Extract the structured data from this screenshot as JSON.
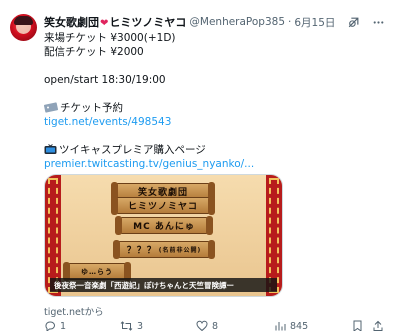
{
  "post": {
    "author": {
      "display_name": "笑女歌劇団",
      "display_name_suffix": "ヒミツノミヤコ",
      "handle": "@MenheraPop385",
      "separator": "·",
      "date": "6月15日"
    },
    "lines": [
      "来場チケット ¥3000(+1D)",
      "配信チケット ¥2000",
      "",
      "open/start 18:30/19:00",
      "",
      "チケット予約",
      "tiget.net/events/498543",
      "",
      "ツイキャスプレミア購入ページ",
      "premier.twitcasting.tv/genius_nyanko/..."
    ],
    "media": {
      "scroll_texts": [
        "笑女歌劇団",
        "ヒミツノミヤコ",
        "MC あんにゅ",
        "？？？",
        "ゆ…らう"
      ],
      "scroll_small": "(名前非公開)",
      "caption": "後夜祭一音楽劇「西遊記」ぽけちゃんと天竺冒険譚ー"
    },
    "source_label": "tiget.netから",
    "metrics": {
      "replies": "1",
      "reposts": "3",
      "likes": "8",
      "views": "845"
    },
    "colors": {
      "link": "#1d9bf0",
      "muted": "#536471",
      "text": "#0f1419",
      "verified_heart": "#e0245e"
    }
  }
}
